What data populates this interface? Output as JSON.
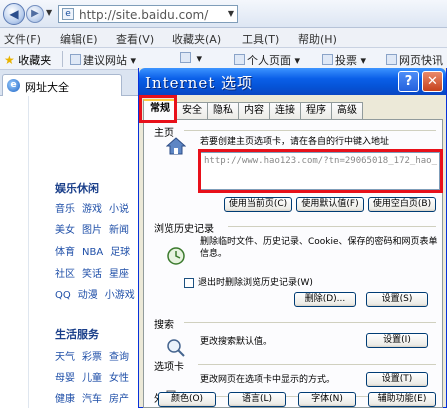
{
  "browser": {
    "address": "http://site.baidu.com/",
    "menu": [
      "文件(F)",
      "编辑(E)",
      "查看(V)",
      "收藏夹(A)",
      "工具(T)",
      "帮助(H)"
    ],
    "favorites_label": "收藏夹",
    "fav_links": [
      "建议网站",
      "",
      "个人页面",
      "投票",
      "网页快讯"
    ],
    "tab_title": "网址大全"
  },
  "page": {
    "categories": [
      {
        "title": "娱乐休闲",
        "rows": [
          [
            "音乐",
            "游戏",
            "小说"
          ],
          [
            "美女",
            "图片",
            "新闻"
          ],
          [
            "体育",
            "NBA",
            "足球"
          ],
          [
            "社区",
            "笑话",
            "星座"
          ],
          [
            "QQ",
            "动漫",
            "小游戏"
          ]
        ]
      },
      {
        "title": "生活服务",
        "rows": [
          [
            "天气",
            "彩票",
            "查询"
          ],
          [
            "母婴",
            "儿童",
            "女性"
          ],
          [
            "健康",
            "汽车",
            "房产"
          ]
        ]
      }
    ]
  },
  "dialog": {
    "title": "Internet 选项",
    "help_label": "?",
    "close_label": "✕",
    "tabs": [
      "常规",
      "安全",
      "隐私",
      "内容",
      "连接",
      "程序",
      "高级"
    ],
    "active_tab": 0,
    "home": {
      "title": "主页",
      "desc": "若要创建主页选项卡，请在各自的行中键入地址",
      "url": "http://www.hao123.com/?tn=29065018_172_hao_",
      "btn_current": "使用当前页(C)",
      "btn_default": "使用默认值(F)",
      "btn_blank": "使用空白页(B)"
    },
    "history": {
      "title": "浏览历史记录",
      "desc": "删除临时文件、历史记录、Cookie、保存的密码和网页表单信息。",
      "checkbox": "退出时删除浏览历史记录(W)",
      "btn_delete": "删除(D)...",
      "btn_settings": "设置(S)"
    },
    "search": {
      "title": "搜索",
      "desc": "更改搜索默认值。",
      "btn_settings": "设置(I)"
    },
    "tabsec": {
      "title": "选项卡",
      "desc": "更改网页在选项卡中显示的方式。",
      "btn_settings": "设置(T)"
    },
    "appearance": {
      "title": "外观",
      "btn_colors": "颜色(O)",
      "btn_languages": "语言(L)",
      "btn_fonts": "字体(N)",
      "btn_access": "辅助功能(E)"
    }
  }
}
